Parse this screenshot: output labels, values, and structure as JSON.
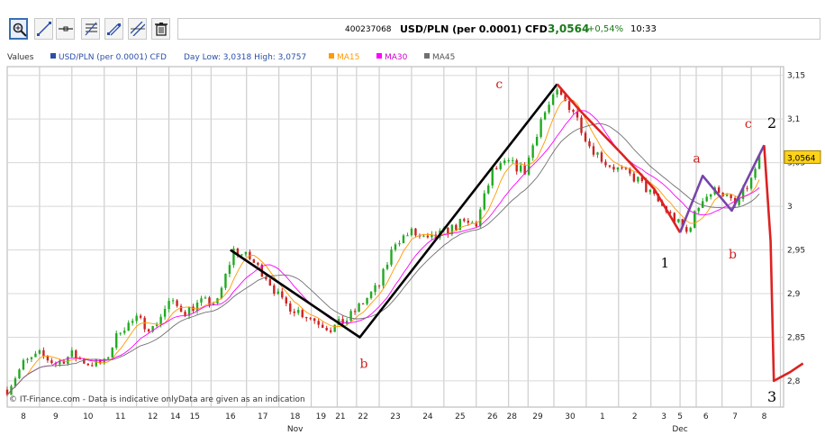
{
  "toolbar": {
    "tools": [
      "zoom-icon",
      "line-icon",
      "horizontal-line-icon",
      "fibonacci-icon",
      "channel-icon",
      "parallel-lines-icon",
      "trash-icon"
    ],
    "instrument_id": "400237068",
    "instrument_name": "USD/PLN (per 0.0001) CFD",
    "last_price": "3,0564",
    "change": "+0,54%",
    "time": "10:33"
  },
  "legend": {
    "values_label": "Values",
    "series_label": "USD/PLN (per 0.0001) CFD",
    "day_range": "Day Low: 3,0318 High: 3,0757",
    "ma15": "MA15",
    "ma30": "MA30",
    "ma45": "MA45"
  },
  "footer": {
    "copyright": "© IT-Finance.com - Data is indicative onlyData are given as an indication"
  },
  "colors": {
    "ma15": "#ff9900",
    "ma30": "#ff00ff",
    "ma45": "#707070",
    "up_candle": "#22aa22",
    "down_candle": "#cc2222",
    "wave_black": "#000000",
    "wave_red": "#dd2222",
    "wave_purple": "#7744aa",
    "price_tag": "#ffd21a"
  },
  "chart_data": {
    "type": "line",
    "ylim": [
      2.77,
      3.16
    ],
    "y_ticks": [
      "3,15",
      "3,1",
      "3,05",
      "3",
      "2,95",
      "2,9",
      "2,85",
      "2,8"
    ],
    "y_tick_values": [
      3.15,
      3.1,
      3.05,
      3.0,
      2.95,
      2.9,
      2.85,
      2.8
    ],
    "x_ticks": [
      "8",
      "9",
      "10",
      "11",
      "12",
      "14",
      "15",
      "16",
      "17",
      "18",
      "19",
      "21",
      "22",
      "23",
      "24",
      "25",
      "26",
      "28",
      "29",
      "30",
      "1",
      "2",
      "3",
      "5",
      "6",
      "7",
      "8"
    ],
    "x_tick_index": [
      0.5,
      1.5,
      2.5,
      3.5,
      4.5,
      5.2,
      5.8,
      6.9,
      7.9,
      8.9,
      9.7,
      10.3,
      11.0,
      12.0,
      13.0,
      14.0,
      15.0,
      15.6,
      16.4,
      17.4,
      18.4,
      19.4,
      20.3,
      20.8,
      21.6,
      22.5,
      23.4
    ],
    "x_months": [
      "Nov",
      "Dec"
    ],
    "x_month_index": [
      8.9,
      20.8
    ],
    "n_days": 24,
    "current_price": "3,0564",
    "current_price_value": 3.0564,
    "series": [
      {
        "name": "USD/PLN (per 0.0001) CFD",
        "x": [
          0,
          0.5,
          1,
          1.5,
          2,
          2.5,
          3,
          3.5,
          4,
          4.5,
          5,
          5.5,
          6,
          6.5,
          7,
          7.5,
          8,
          8.5,
          9,
          9.5,
          10,
          10.5,
          11,
          11.5,
          12,
          12.5,
          13,
          13.5,
          14,
          14.5,
          15,
          15.5,
          16,
          16.5,
          17,
          17.5,
          18,
          18.5,
          19,
          19.5,
          20,
          20.5,
          21,
          21.5,
          22,
          22.5,
          23,
          23.3
        ],
        "values": [
          2.79,
          2.82,
          2.83,
          2.82,
          2.83,
          2.82,
          2.82,
          2.86,
          2.87,
          2.86,
          2.89,
          2.88,
          2.89,
          2.89,
          2.95,
          2.94,
          2.92,
          2.89,
          2.88,
          2.87,
          2.86,
          2.87,
          2.89,
          2.91,
          2.96,
          2.97,
          2.96,
          2.97,
          2.98,
          2.98,
          3.04,
          3.05,
          3.04,
          3.1,
          3.13,
          3.11,
          3.07,
          3.05,
          3.04,
          3.03,
          3.01,
          2.99,
          2.97,
          3.01,
          3.02,
          3.0,
          3.03,
          3.06
        ]
      }
    ],
    "wave_labels": [
      "b",
      "c",
      "1",
      "a",
      "b",
      "c",
      "2",
      "3"
    ],
    "wave_paths": [
      {
        "name": "wave-abc-black",
        "points": [
          [
            6.9,
            2.95
          ],
          [
            10.9,
            2.85
          ],
          [
            17.0,
            3.14
          ]
        ]
      },
      {
        "name": "wave-1-red",
        "points": [
          [
            17.0,
            3.14
          ],
          [
            17.7,
            3.11
          ],
          [
            19.0,
            3.06
          ],
          [
            20.0,
            3.02
          ],
          [
            20.8,
            2.97
          ]
        ]
      },
      {
        "name": "wave-2-purple",
        "points": [
          [
            20.8,
            2.97
          ],
          [
            21.5,
            3.035
          ],
          [
            22.4,
            2.995
          ],
          [
            23.4,
            3.07
          ]
        ]
      },
      {
        "name": "wave-3-red",
        "points": [
          [
            23.4,
            3.07
          ],
          [
            23.6,
            2.96
          ],
          [
            23.7,
            2.8
          ],
          [
            24.2,
            2.81
          ],
          [
            24.6,
            2.82
          ]
        ]
      }
    ]
  }
}
